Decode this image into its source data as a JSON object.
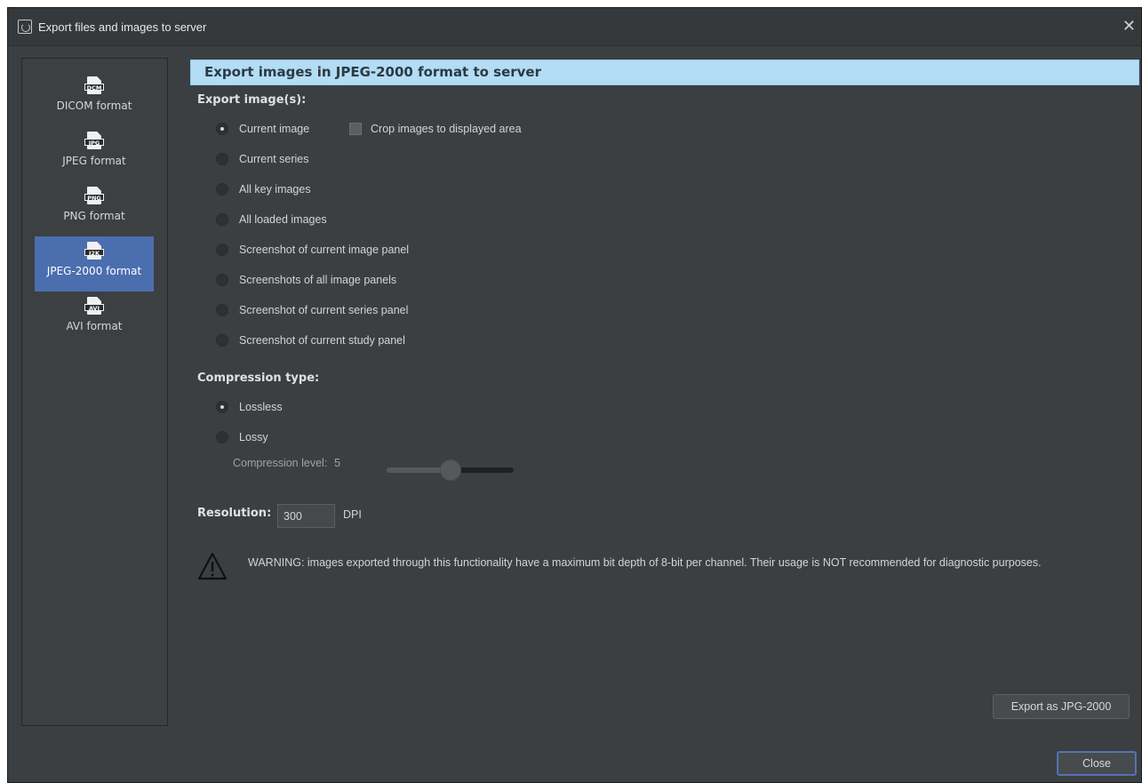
{
  "window": {
    "title": "Export files and images to server",
    "close_glyph": "✕"
  },
  "sidebar": {
    "items": [
      {
        "label": "DICOM format",
        "icon_tag": "DCM",
        "icon": "dcm-file-icon",
        "selected": false
      },
      {
        "label": "JPEG format",
        "icon_tag": "JPG",
        "icon": "jpg-file-icon",
        "selected": false
      },
      {
        "label": "PNG format",
        "icon_tag": "PNG",
        "icon": "png-file-icon",
        "selected": false
      },
      {
        "label": "JPEG-2000 format",
        "icon_tag": "J2K",
        "icon": "j2k-file-icon",
        "selected": true
      },
      {
        "label": "AVI format",
        "icon_tag": "AVI",
        "icon": "avi-file-icon",
        "selected": false
      }
    ]
  },
  "main": {
    "header": "Export images in JPEG-2000 format to server",
    "export_section": {
      "label": "Export image(s):",
      "options": [
        {
          "label": "Current image",
          "checked": true
        },
        {
          "label": "Current series",
          "checked": false
        },
        {
          "label": "All key images",
          "checked": false
        },
        {
          "label": "All loaded images",
          "checked": false
        },
        {
          "label": "Screenshot of current image panel",
          "checked": false
        },
        {
          "label": "Screenshots of all image panels",
          "checked": false
        },
        {
          "label": "Screenshot of current series panel",
          "checked": false
        },
        {
          "label": "Screenshot of current study panel",
          "checked": false
        }
      ],
      "crop_checkbox": {
        "label": "Crop images to displayed area",
        "checked": false
      }
    },
    "compression_section": {
      "label": "Compression type:",
      "options": [
        {
          "label": "Lossless",
          "checked": true
        },
        {
          "label": "Lossy",
          "checked": false
        }
      ],
      "level_label": "Compression level:",
      "level_value": "5",
      "slider_fraction": 0.5
    },
    "resolution": {
      "label": "Resolution:",
      "value": "300",
      "unit": "DPI"
    },
    "warning": {
      "icon": "warning-triangle-icon",
      "text": "WARNING: images exported through this functionality have a maximum bit depth of 8-bit per channel. Their usage is NOT recommended for diagnostic purposes."
    },
    "export_button": "Export as JPG-2000"
  },
  "footer": {
    "close_button": "Close"
  },
  "colors": {
    "window_bg": "#3b3f42",
    "selected_bg": "#4b6eaf",
    "header_bg": "#b3dcf5"
  }
}
